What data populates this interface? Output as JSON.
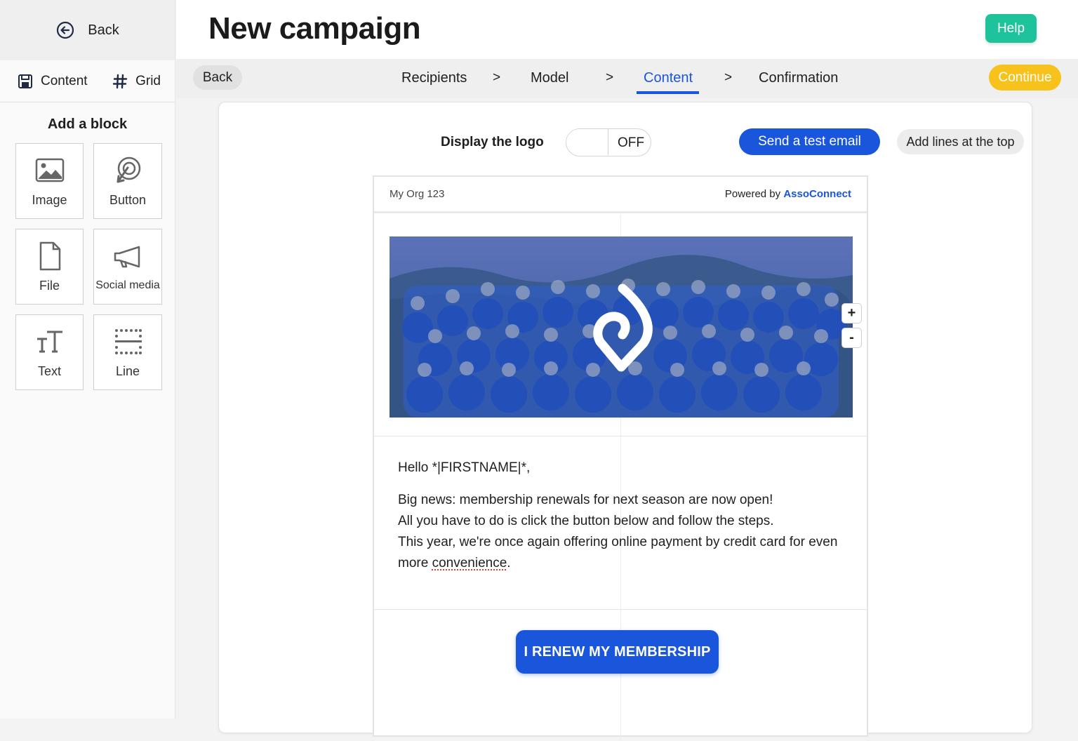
{
  "sidebar": {
    "back_label": "Back",
    "tabs": [
      {
        "label": "Content",
        "icon": "save-icon"
      },
      {
        "label": "Grid",
        "icon": "hash-icon"
      }
    ],
    "heading": "Add a block",
    "blocks": [
      {
        "label": "Image",
        "icon": "image-icon"
      },
      {
        "label": "Button",
        "icon": "cursor-click-icon"
      },
      {
        "label": "File",
        "icon": "file-icon"
      },
      {
        "label": "Social media",
        "icon": "megaphone-icon"
      },
      {
        "label": "Text",
        "icon": "text-size-icon"
      },
      {
        "label": "Line",
        "icon": "dotted-lines-icon"
      }
    ]
  },
  "header": {
    "title": "New campaign",
    "help_label": "Help"
  },
  "steps": {
    "back_label": "Back",
    "items": [
      "Recipients",
      "Model",
      "Content",
      "Confirmation"
    ],
    "active": "Content",
    "separator": ">",
    "continue_label": "Continue"
  },
  "toolbar": {
    "logo_label": "Display the logo",
    "logo_toggle_state": "OFF",
    "test_email_label": "Send a test email",
    "add_lines_label": "Add lines at the top"
  },
  "email": {
    "org_name": "My Org 123",
    "powered_by_prefix": "Powered by",
    "powered_by_brand": "AssoConnect",
    "image_zoom_in": "+",
    "image_zoom_out": "-",
    "greeting": "Hello *|FIRSTNAME|*,",
    "body_lines": [
      "Big news: membership renewals for next season are now open!",
      "All you have to do is click the button below and follow the steps.",
      "This year, we're once again offering online payment by credit card for even more"
    ],
    "body_last_word": "convenience",
    "body_end": ".",
    "cta_label": "I RENEW MY MEMBERSHIP"
  },
  "colors": {
    "primary": "#1a56db",
    "help": "#1fc39b",
    "continue": "#f7c21b"
  }
}
